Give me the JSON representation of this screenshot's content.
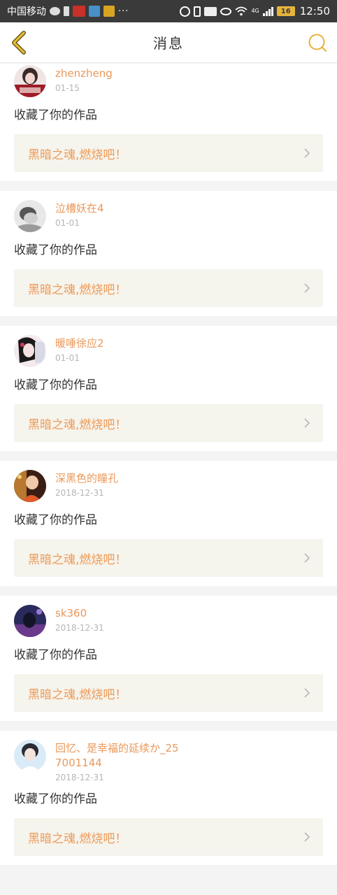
{
  "status_bar": {
    "carrier": "中国移动",
    "dots": "···",
    "network": "4G",
    "battery": "16",
    "time": "12:50"
  },
  "header": {
    "title": "消息",
    "back_icon": "chevron-left-icon",
    "search_icon": "search-icon",
    "accent_color": "#e9b23a"
  },
  "colors": {
    "username": "#e9985b",
    "work_title": "#ee9a57",
    "work_bg": "#f5f4ed"
  },
  "messages": [
    {
      "username": "zhenzheng",
      "date": "01-15",
      "action": "收藏了你的作品",
      "work": "黑暗之魂,燃烧吧！",
      "avatar": "avatar-pink"
    },
    {
      "username": "泣槽妖在4",
      "date": "01-01",
      "action": "收藏了你的作品",
      "work": "黑暗之魂,燃烧吧！",
      "avatar": "avatar-gray"
    },
    {
      "username": "暖唾徐应2",
      "date": "01-01",
      "action": "收藏了你的作品",
      "work": "黑暗之魂,燃烧吧！",
      "avatar": "avatar-anime"
    },
    {
      "username": "深黑色的瞳孔",
      "date": "2018-12-31",
      "action": "收藏了你的作品",
      "work": "黑暗之魂,燃烧吧！",
      "avatar": "avatar-warm"
    },
    {
      "username": "sk360",
      "date": "2018-12-31",
      "action": "收藏了你的作品",
      "work": "黑暗之魂,燃烧吧！",
      "avatar": "avatar-purple"
    },
    {
      "username": "回忆、是幸福的延续か_257001144",
      "date": "2018-12-31",
      "action": "收藏了你的作品",
      "work": "黑暗之魂,燃烧吧！",
      "avatar": "avatar-light"
    }
  ]
}
